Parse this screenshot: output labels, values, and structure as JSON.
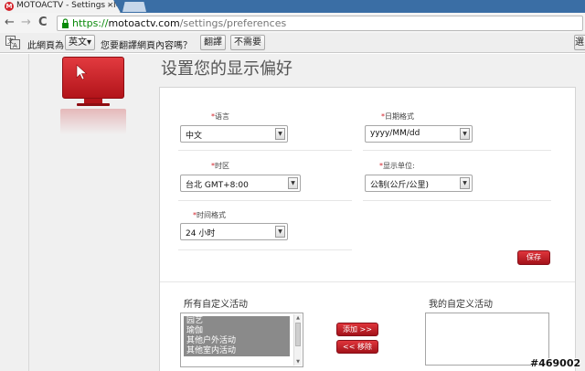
{
  "browser": {
    "tab_title": "MOTOACTV - Settings - M",
    "tab_close": "×",
    "favicon_letter": "M",
    "back_glyph": "←",
    "forward_glyph": "→",
    "reload_glyph": "C",
    "url_scheme": "https://",
    "url_host": "motoactv.com",
    "url_path": "/settings/preferences"
  },
  "translate_bar": {
    "prompt_prefix": "此網頁為",
    "language": "英文",
    "language_caret": "▾",
    "prompt_question": "您要翻譯網頁內容嗎？",
    "translate_label": "翻譯",
    "decline_label": "不需要",
    "options_label": "選項"
  },
  "page": {
    "title": "设置您的显示偏好",
    "fields": {
      "required_mark": "*",
      "language": {
        "label": "语言",
        "value": "中文"
      },
      "date_format": {
        "label": "日期格式",
        "value": "yyyy/MM/dd"
      },
      "timezone": {
        "label": "时区",
        "value": "台北 GMT+8:00"
      },
      "units": {
        "label": "显示单位:",
        "value": "公制(公斤/公里)"
      },
      "time_format": {
        "label": "时间格式",
        "value": "24 小时"
      }
    },
    "select_arrow": "▼",
    "save_label": "保存",
    "all_activities": {
      "title": "所有自定义活动",
      "items": [
        "园艺",
        "瑜伽",
        "其他户外活动",
        "其他室内活动"
      ]
    },
    "add_label": "添加 >>",
    "remove_label": "<< 移除",
    "my_activities": {
      "title": "我的自定义活动"
    }
  },
  "watermark": "#469002",
  "colors": {
    "brand_red": "#d3222a",
    "url_green": "#0a8a0a"
  }
}
